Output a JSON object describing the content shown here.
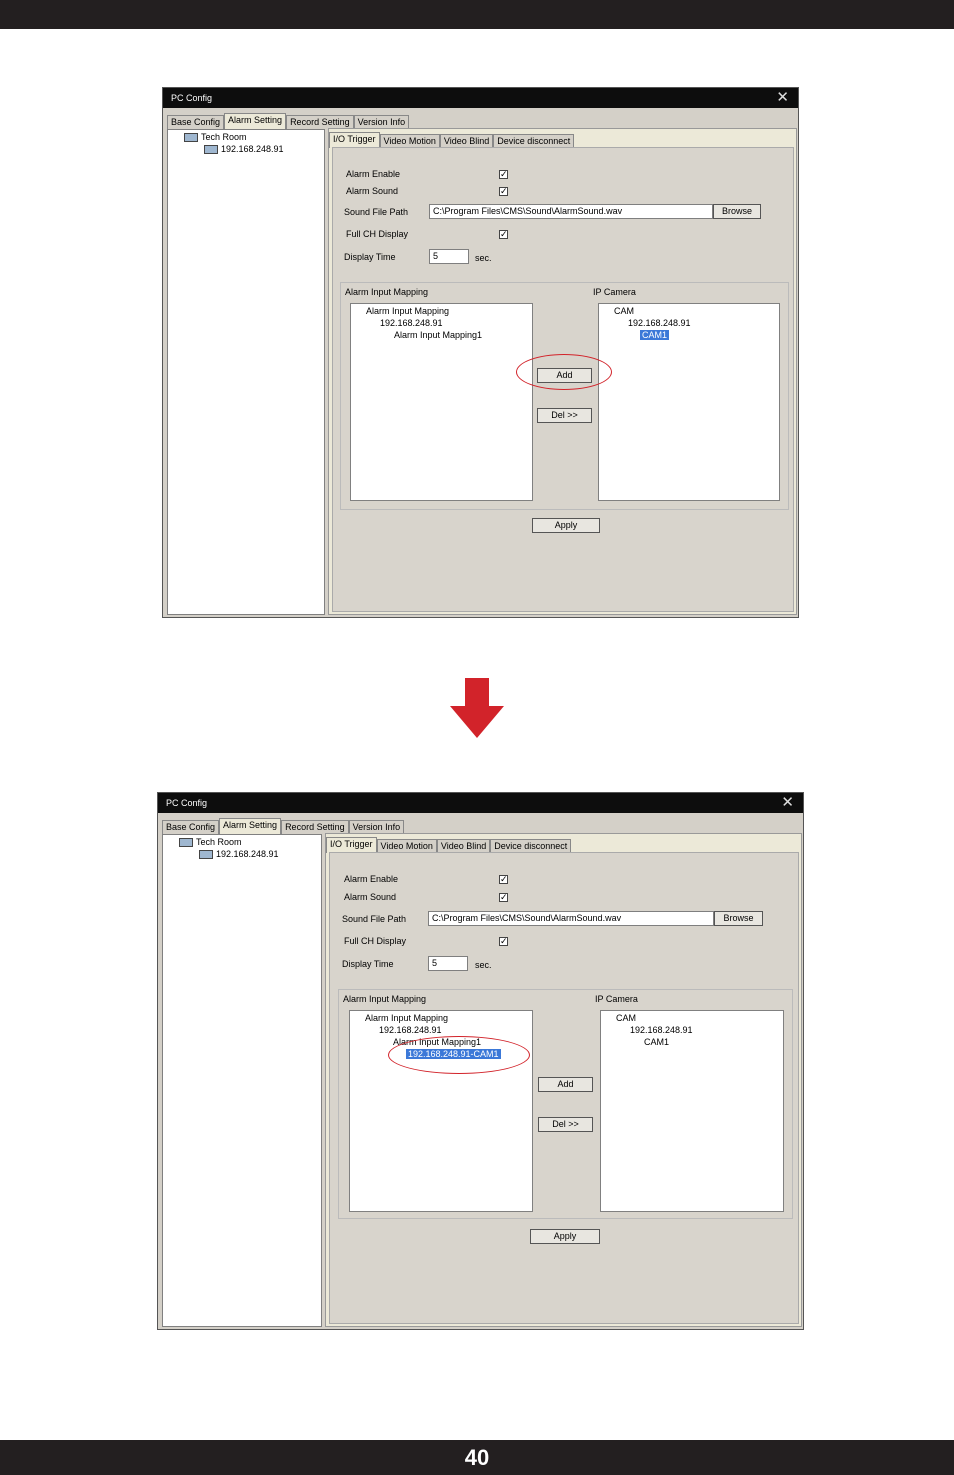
{
  "page_number": "40",
  "window": {
    "title": "PC Config",
    "top_tabs": [
      "Base Config",
      "Alarm Setting",
      "Record Setting",
      "Version Info"
    ],
    "tree_root": "Tech Room",
    "tree_child": "192.168.248.91",
    "sub_tabs": [
      "I/O Trigger",
      "Video Motion",
      "Video Blind",
      "Device disconnect"
    ],
    "alarm_enable_label": "Alarm Enable",
    "alarm_sound_label": "Alarm Sound",
    "sound_file_path_label": "Sound File Path",
    "sound_file_path_value": "C:\\Program Files\\CMS\\Sound\\AlarmSound.wav",
    "browse_label": "Browse",
    "full_ch_display_label": "Full CH Display",
    "display_time_label": "Display Time",
    "display_time_value": "5",
    "sec_label": "sec.",
    "alarm_input_mapping_title": "Alarm Input Mapping",
    "ip_camera_title": "IP Camera",
    "add_label": "Add",
    "del_label": "Del >>",
    "apply_label": "Apply",
    "checkbox_mark": "✓"
  },
  "before": {
    "left_tree": [
      "Alarm Input Mapping",
      "192.168.248.91",
      "Alarm Input Mapping1"
    ],
    "right_tree": [
      "CAM",
      "192.168.248.91",
      "CAM1"
    ]
  },
  "after": {
    "left_tree": [
      "Alarm Input Mapping",
      "192.168.248.91",
      "Alarm Input Mapping1",
      "192.168.248.91-CAM1"
    ],
    "right_tree": [
      "CAM",
      "192.168.248.91",
      "CAM1"
    ]
  },
  "colors": {
    "highlight": "#d2232a",
    "selection": "#3b78d8",
    "bar": "#231f20"
  }
}
